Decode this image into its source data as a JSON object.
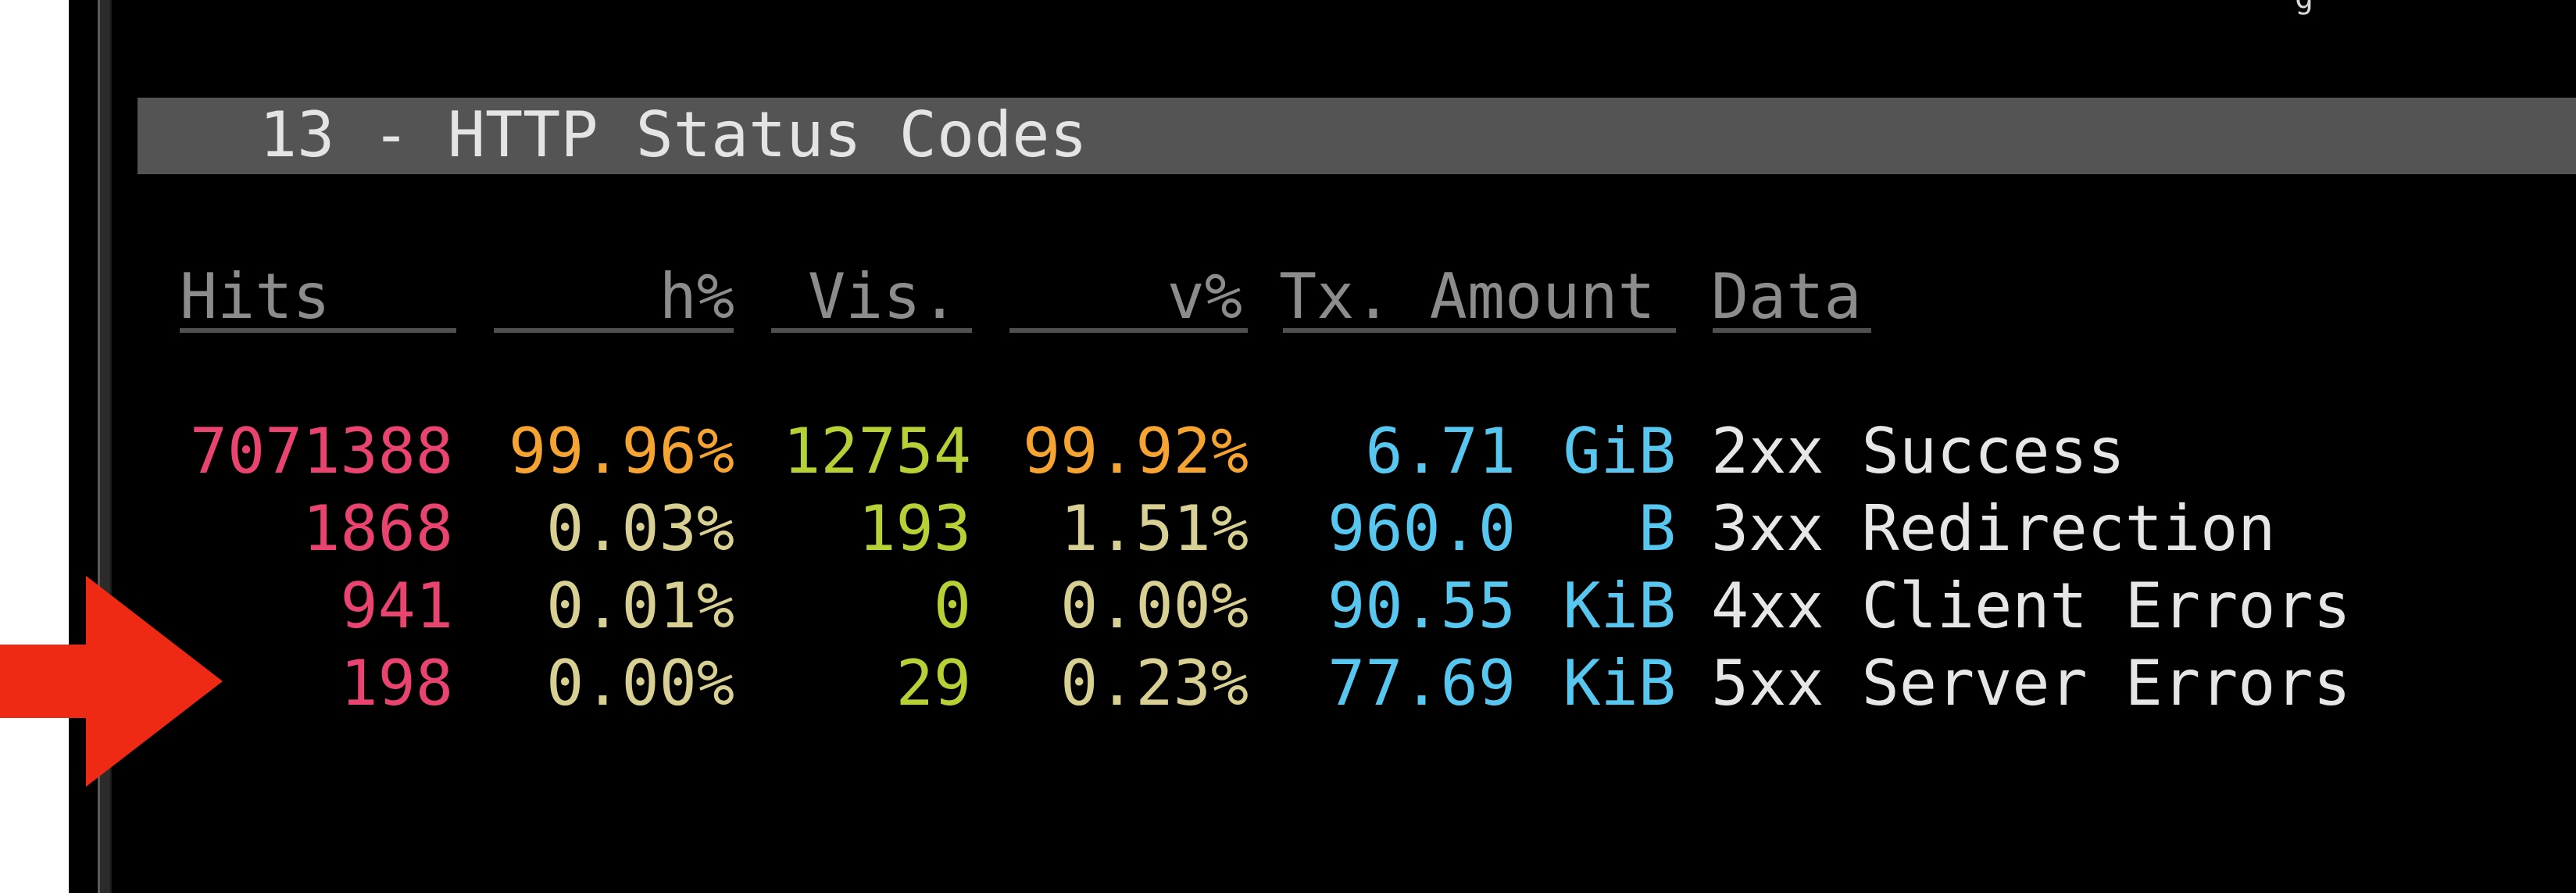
{
  "panel": {
    "title": "13 - HTTP Status Codes"
  },
  "columns": {
    "hits": "Hits",
    "hits_pct": "h%",
    "visitors": "Vis.",
    "visitors_pct": "v%",
    "tx_amount": "Tx. Amount",
    "data": "Data"
  },
  "rows": [
    {
      "hits": "7071388",
      "hits_pct": "99.96%",
      "visitors": "12754",
      "visitors_pct": "99.92%",
      "tx_value": "6.71",
      "tx_unit": "GiB",
      "data": "2xx Success"
    },
    {
      "hits": "1868",
      "hits_pct": "0.03%",
      "visitors": "193",
      "visitors_pct": "1.51%",
      "tx_value": "960.0",
      "tx_unit": "B",
      "data": "3xx Redirection"
    },
    {
      "hits": "941",
      "hits_pct": "0.01%",
      "visitors": "0",
      "visitors_pct": "0.00%",
      "tx_value": "90.55",
      "tx_unit": "KiB",
      "data": "4xx Client Errors"
    },
    {
      "hits": "198",
      "hits_pct": "0.00%",
      "visitors": "29",
      "visitors_pct": "0.23%",
      "tx_value": "77.69",
      "tx_unit": "KiB",
      "data": "5xx Server Errors"
    }
  ],
  "colors": {
    "terminal_background": "#000000",
    "header_bar": "#545454",
    "hits": "#e8446f",
    "percent_highlight": "#f5a331",
    "percent_normal": "#d8cf92",
    "visitors": "#b5d136",
    "tx_amount": "#58c7ef",
    "data_text": "#e6e6e6",
    "arrow": "#ef2a14"
  },
  "icons": {
    "annotation_arrow": "red-arrow-icon"
  }
}
